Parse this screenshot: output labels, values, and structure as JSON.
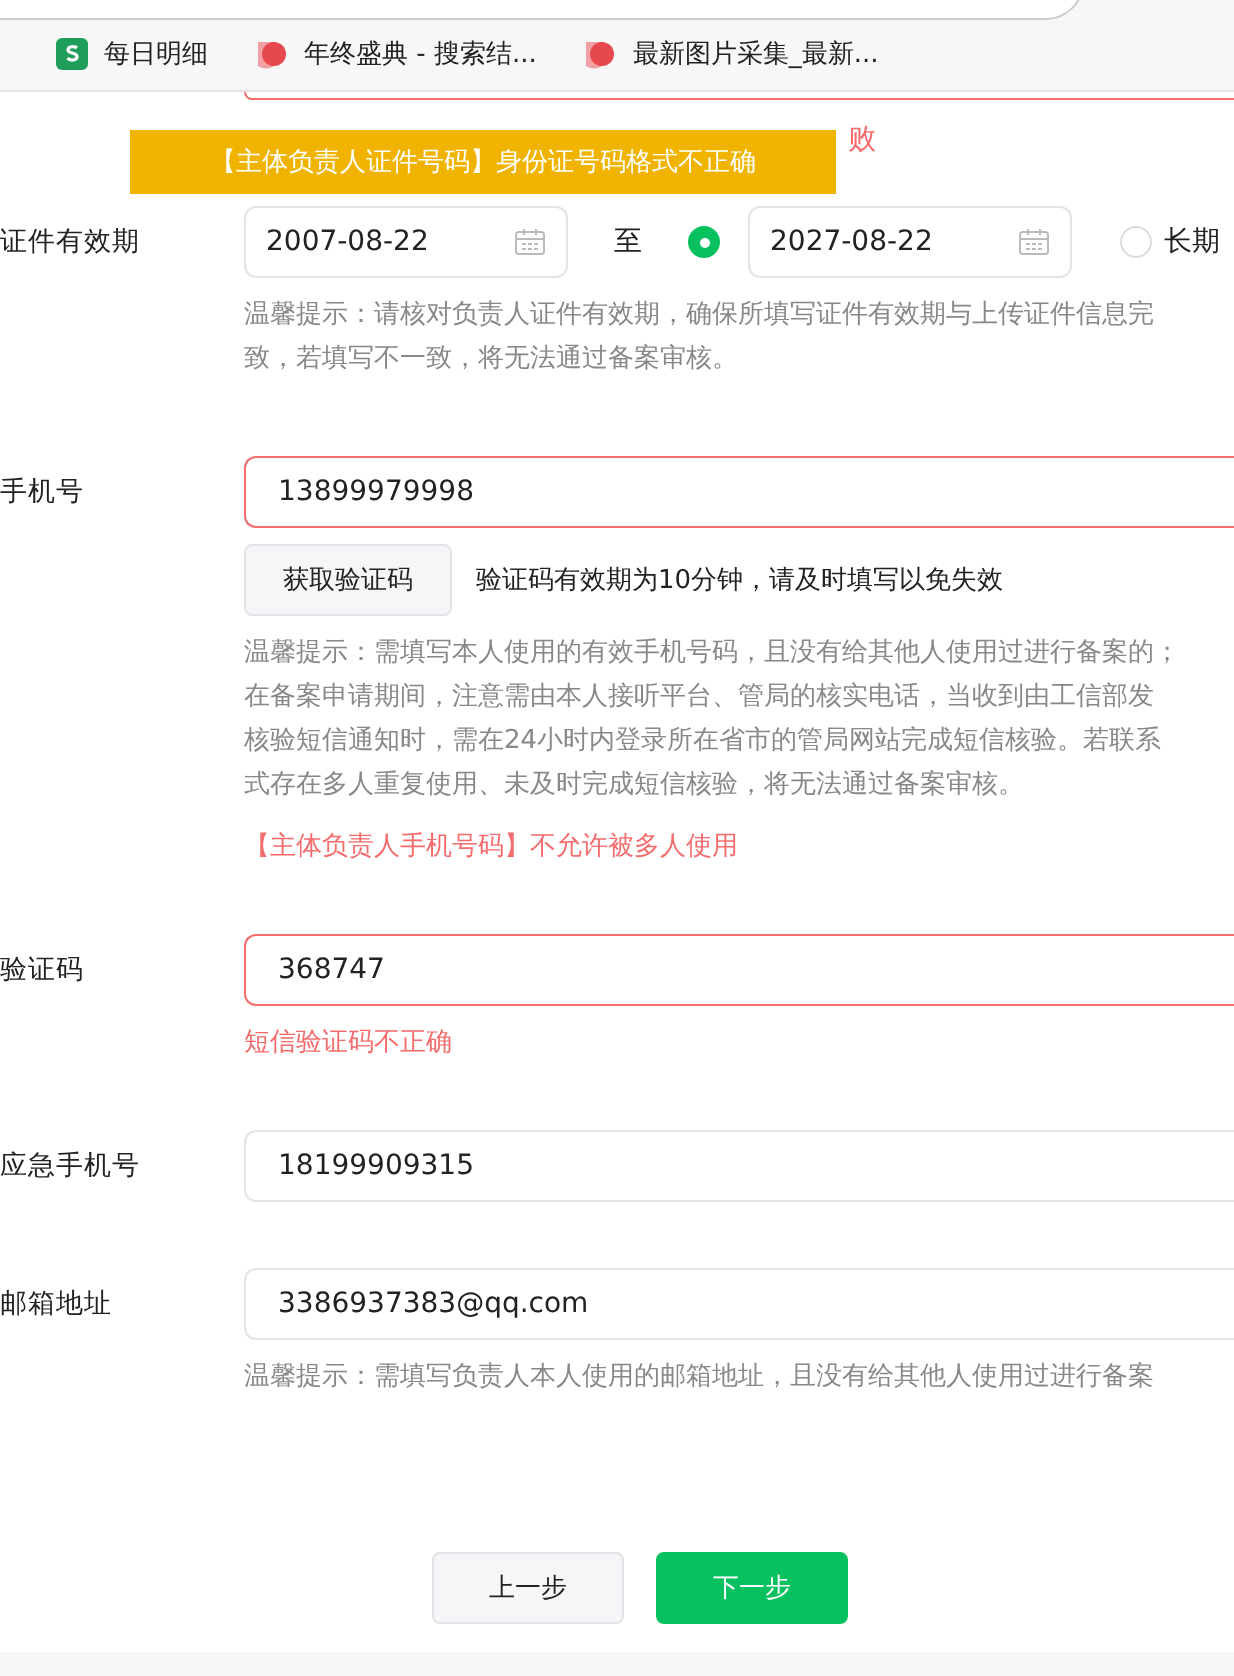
{
  "bookmarks": [
    {
      "label": "每日明细",
      "kind": "sheet"
    },
    {
      "label": "年终盛典 - 搜索结...",
      "kind": "site"
    },
    {
      "label": "最新图片采集_最新...",
      "kind": "site"
    }
  ],
  "toast": "【主体负责人证件号码】身份证号码格式不正确",
  "id_error_tail": "败",
  "validity": {
    "label": "证件有效期",
    "start": "2007-08-22",
    "separator": "至",
    "end_selected": true,
    "end": "2027-08-22",
    "long_term": {
      "label": "长期",
      "selected": false
    },
    "hint": [
      "温馨提示：请核对负责人证件有效期，确保所填写证件有效期与上传证件信息完",
      "致，若填写不一致，将无法通过备案审核。"
    ]
  },
  "phone": {
    "label": "手机号",
    "value": "13899979998",
    "invalid": true,
    "code_button": "获取验证码",
    "code_note": "验证码有效期为10分钟，请及时填写以免失效",
    "hint": [
      "温馨提示：需填写本人使用的有效手机号码，且没有给其他人使用过进行备案的；",
      "在备案申请期间，注意需由本人接听平台、管局的核实电话，当收到由工信部发",
      "核验短信通知时，需在24小时内登录所在省市的管局网站完成短信核验。若联系",
      "式存在多人重复使用、未及时完成短信核验，将无法通过备案审核。"
    ],
    "error": "【主体负责人手机号码】不允许被多人使用"
  },
  "code": {
    "label": "验证码",
    "value": "368747",
    "invalid": true,
    "error": "短信验证码不正确"
  },
  "emergency": {
    "label": "应急手机号",
    "value": "18199909315",
    "invalid": false
  },
  "email": {
    "label": "邮箱地址",
    "value": "3386937383@qq.com",
    "invalid": false,
    "hint": [
      "温馨提示：需填写负责人本人使用的邮箱地址，且没有给其他人使用过进行备案"
    ]
  },
  "buttons": {
    "prev": "上一步",
    "next": "下一步"
  }
}
